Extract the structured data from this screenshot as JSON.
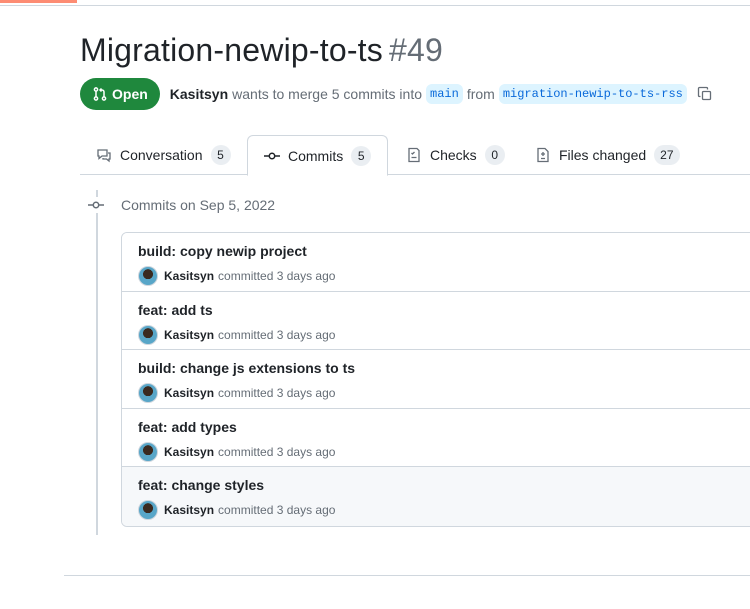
{
  "pr": {
    "title": "Migration-newip-to-ts",
    "number": "#49",
    "state": "Open",
    "author": "Kasitsyn",
    "summary_pre": "wants to merge 5 commits into",
    "base_branch": "main",
    "from_text": "from",
    "head_branch": "migration-newip-to-ts-rss"
  },
  "tabs": [
    {
      "label": "Conversation",
      "count": "5",
      "icon": "comment-icon"
    },
    {
      "label": "Commits",
      "count": "5",
      "icon": "git-commit-icon"
    },
    {
      "label": "Checks",
      "count": "0",
      "icon": "checklist-icon"
    },
    {
      "label": "Files changed",
      "count": "27",
      "icon": "file-diff-icon"
    }
  ],
  "commits_header": "Commits on Sep 5, 2022",
  "commits": [
    {
      "message": "build: copy newip project",
      "author": "Kasitsyn",
      "action": "committed 3 days ago"
    },
    {
      "message": "feat: add ts",
      "author": "Kasitsyn",
      "action": "committed 3 days ago"
    },
    {
      "message": "build: change js extensions to ts",
      "author": "Kasitsyn",
      "action": "committed 3 days ago"
    },
    {
      "message": "feat: add types",
      "author": "Kasitsyn",
      "action": "committed 3 days ago"
    },
    {
      "message": "feat: change styles",
      "author": "Kasitsyn",
      "action": "committed 3 days ago"
    }
  ],
  "colors": {
    "open_green": "#1f883d",
    "branch_blue": "#0969da",
    "accent_orange": "#fd8c73"
  }
}
